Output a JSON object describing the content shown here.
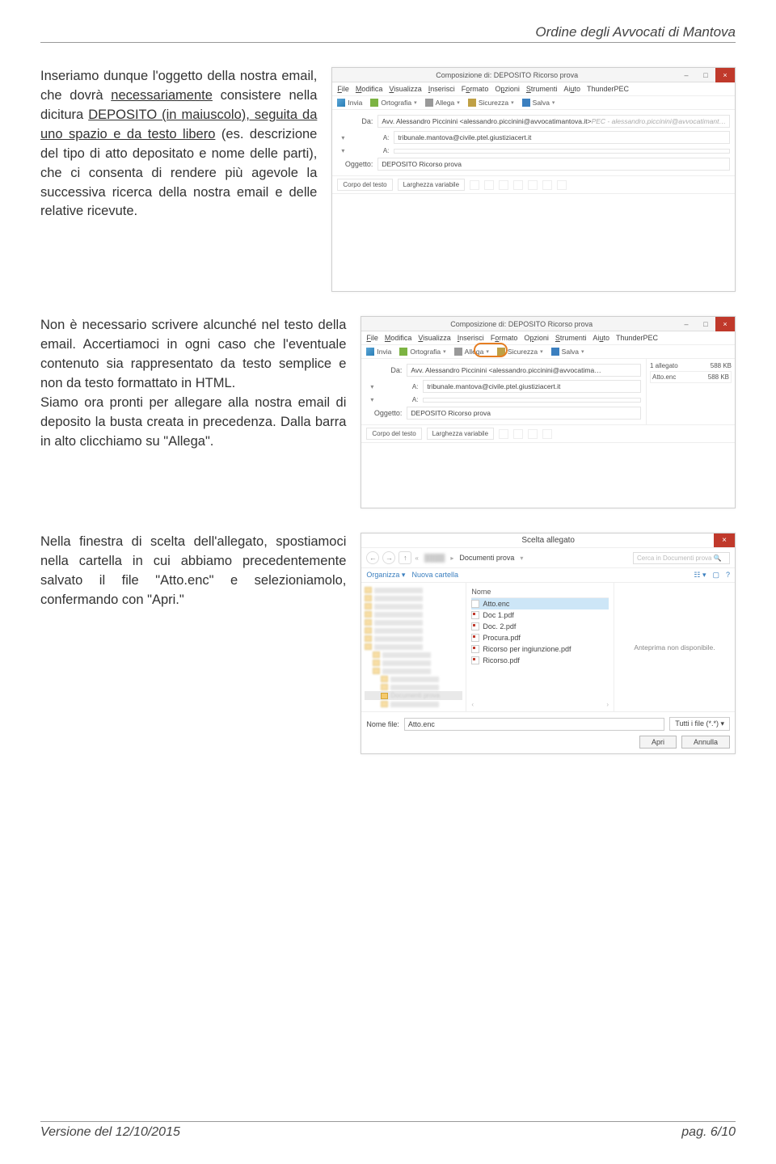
{
  "header": {
    "text": "Ordine degli Avvocati di Mantova"
  },
  "para1": {
    "pre": "Inseriamo dunque l'oggetto della nostra email, che dovrà ",
    "u1": "necessariamente",
    "mid": " consistere nella dicitura ",
    "u2": "DEPOSITO (in maiuscolo), seguita da uno spazio e da testo libero",
    "post": " (es. descrizione del tipo di atto depositato e nome delle parti), che ci consenta di rendere più agevole la successiva ricerca della nostra email e delle relative ricevute."
  },
  "para2": "Non è necessario scrivere alcunché nel testo della email. Accertiamoci in ogni caso che l'eventuale contenuto sia rappresentato da testo semplice e non da testo formattato in HTML.\nSiamo ora pronti per allegare alla nostra email di deposito la busta creata in precedenza. Dalla barra in alto clicchiamo su \"Allega\".",
  "para3": "Nella finestra di scelta dell'allegato, spostiamoci nella cartella in cui abbiamo precedentemente salvato il file \"Atto.enc\" e selezioniamolo, confermando con \"Apri.\"",
  "compose": {
    "title": "Composizione di: DEPOSITO Ricorso prova",
    "menu": [
      "File",
      "Modifica",
      "Visualizza",
      "Inserisci",
      "Formato",
      "Opzioni",
      "Strumenti",
      "Aiuto",
      "ThunderPEC"
    ],
    "toolbar": {
      "send": "Invia",
      "spell": "Ortografia",
      "attach": "Allega",
      "security": "Sicurezza",
      "save": "Salva"
    },
    "labels": {
      "da": "Da:",
      "a": "A:",
      "oggetto": "Oggetto:",
      "corpo": "Corpo del testo",
      "width": "Larghezza variabile"
    },
    "from": "Avv. Alessandro Piccinini <alessandro.piccinini@avvocatimantova.it>",
    "from_hint": "PEC - alessandro.piccinini@avvocatimant…",
    "to1": "tribunale.mantova@civile.ptel.giustiziacert.it",
    "subject": "DEPOSITO Ricorso prova"
  },
  "compose2": {
    "from_short": "Avv. Alessandro Piccinini <alessandro.piccinini@avvocatima…",
    "attach_header": "1 allegato",
    "attach_size": "588 KB",
    "attach_name": "Atto.enc"
  },
  "filedlg": {
    "title": "Scelta allegato",
    "breadcrumb": "Documenti prova",
    "search_ph": "Cerca in Documenti prova",
    "organize": "Organizza",
    "newfolder": "Nuova cartella",
    "col_name": "Nome",
    "files": [
      "Atto.enc",
      "Doc 1.pdf",
      "Doc. 2.pdf",
      "Procura.pdf",
      "Ricorso per ingiunzione.pdf",
      "Ricorso.pdf"
    ],
    "preview": "Anteprima non disponibile.",
    "filename_lab": "Nome file:",
    "filename_val": "Atto.enc",
    "filter": "Tutti i file (*.*)",
    "open": "Apri",
    "cancel": "Annulla"
  },
  "footer": {
    "left": "Versione del 12/10/2015",
    "right": "pag. 6/10"
  }
}
